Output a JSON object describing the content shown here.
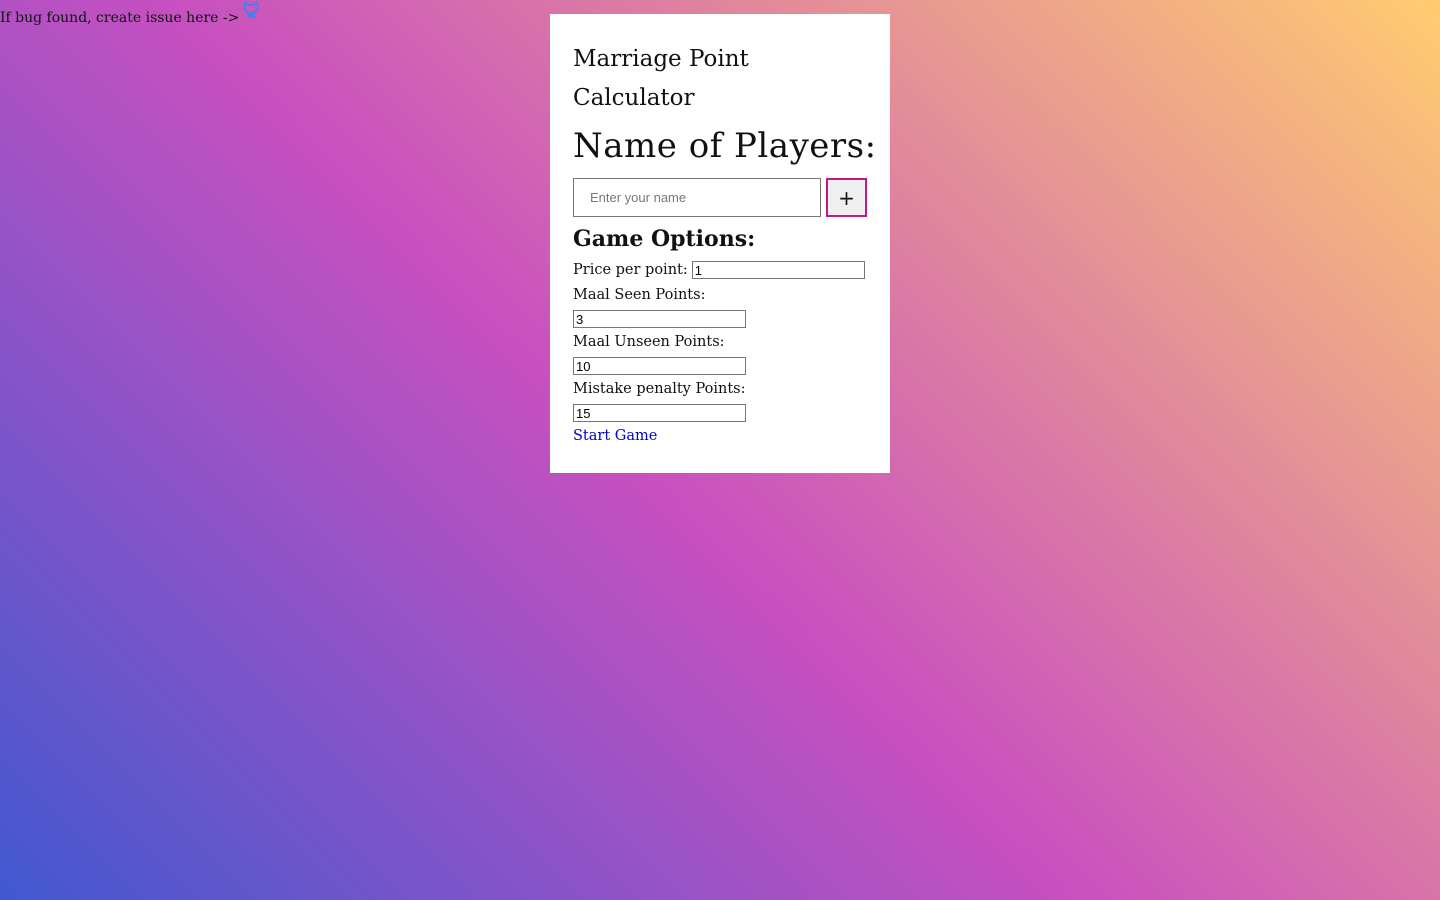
{
  "banner": {
    "text": "If bug found, create issue here ->",
    "icon": "github-icon",
    "icon_color": "#3b82f6"
  },
  "card": {
    "title": "Marriage Point Calculator",
    "players_heading": "Name of Players:",
    "name_placeholder": "Enter your name",
    "add_label": "+",
    "options_heading": "Game Options:",
    "price_label": "Price per point:",
    "price_value": "1",
    "maal_seen_label": "Maal Seen Points:",
    "maal_seen_value": "3",
    "maal_unseen_label": "Maal Unseen Points:",
    "maal_unseen_value": "10",
    "mistake_label": "Mistake penalty Points:",
    "mistake_value": "15",
    "start_label": "Start Game"
  },
  "colors": {
    "gradient_start": "#4158d0",
    "gradient_mid": "#c850c0",
    "gradient_end": "#ffcc70",
    "add_border": "#c2188c",
    "link": "#0000cc"
  }
}
